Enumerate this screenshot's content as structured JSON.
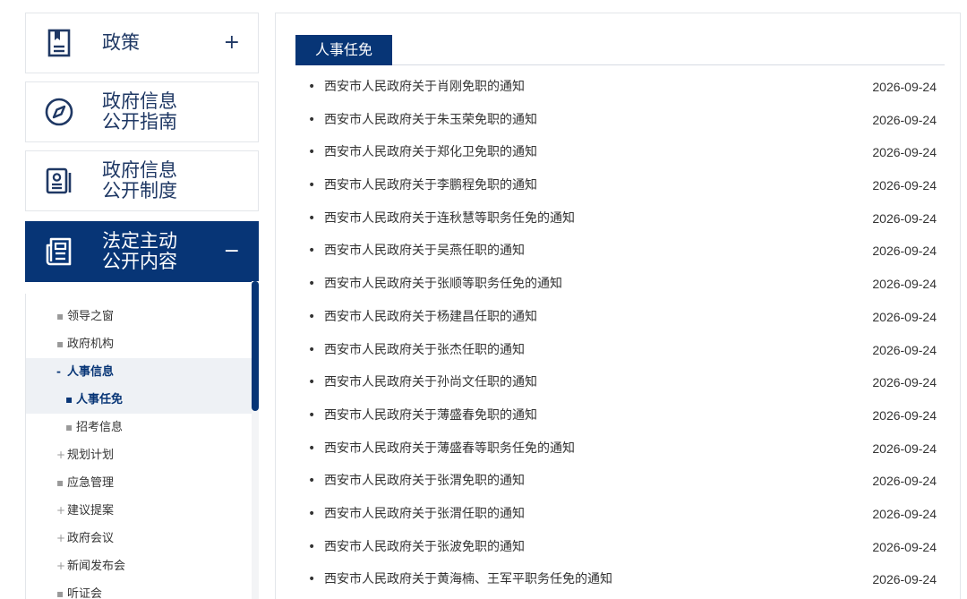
{
  "sidebar": {
    "cards": [
      {
        "label": "政策",
        "toggle": "+",
        "icon": "document-icon"
      },
      {
        "label": "政府信息\n公开指南",
        "toggle": "",
        "icon": "compass-icon"
      },
      {
        "label": "政府信息\n公开制度",
        "toggle": "",
        "icon": "id-card-icon"
      },
      {
        "label": "法定主动\n公开内容",
        "toggle": "−",
        "icon": "newspaper-icon"
      }
    ],
    "submenu": [
      {
        "mark": "▪",
        "label": "领导之窗"
      },
      {
        "mark": "▪",
        "label": "政府机构"
      },
      {
        "mark": "-",
        "label": "人事信息"
      },
      {
        "mark": "▪",
        "label": "人事任免"
      },
      {
        "mark": "▪",
        "label": "招考信息"
      },
      {
        "mark": "+",
        "label": "规划计划"
      },
      {
        "mark": "▪",
        "label": "应急管理"
      },
      {
        "mark": "+",
        "label": "建议提案"
      },
      {
        "mark": "+",
        "label": "政府会议"
      },
      {
        "mark": "+",
        "label": "新闻发布会"
      },
      {
        "mark": "▪",
        "label": "听证会"
      }
    ]
  },
  "main": {
    "tab": "人事任免",
    "bullet": "•",
    "news": [
      {
        "title": "西安市人民政府关于肖刚免职的通知",
        "date": "2026-09-24"
      },
      {
        "title": "西安市人民政府关于朱玉荣免职的通知",
        "date": "2026-09-24"
      },
      {
        "title": "西安市人民政府关于郑化卫免职的通知",
        "date": "2026-09-24"
      },
      {
        "title": "西安市人民政府关于李鹏程免职的通知",
        "date": "2026-09-24"
      },
      {
        "title": "西安市人民政府关于连秋慧等职务任免的通知",
        "date": "2026-09-24"
      },
      {
        "title": "西安市人民政府关于吴燕任职的通知",
        "date": "2026-09-24"
      },
      {
        "title": "西安市人民政府关于张顺等职务任免的通知",
        "date": "2026-09-24"
      },
      {
        "title": "西安市人民政府关于杨建昌任职的通知",
        "date": "2026-09-24"
      },
      {
        "title": "西安市人民政府关于张杰任职的通知",
        "date": "2026-09-24"
      },
      {
        "title": "西安市人民政府关于孙尚文任职的通知",
        "date": "2026-09-24"
      },
      {
        "title": "西安市人民政府关于薄盛春免职的通知",
        "date": "2026-09-24"
      },
      {
        "title": "西安市人民政府关于薄盛春等职务任免的通知",
        "date": "2026-09-24"
      },
      {
        "title": "西安市人民政府关于张渭免职的通知",
        "date": "2026-09-24"
      },
      {
        "title": "西安市人民政府关于张渭任职的通知",
        "date": "2026-09-24"
      },
      {
        "title": "西安市人民政府关于张波免职的通知",
        "date": "2026-09-24"
      },
      {
        "title": "西安市人民政府关于黄海楠、王军平职务任免的通知",
        "date": "2026-09-24"
      }
    ]
  },
  "colors": {
    "accent": "#073576",
    "border": "#e3e6ea",
    "text": "#333333"
  }
}
